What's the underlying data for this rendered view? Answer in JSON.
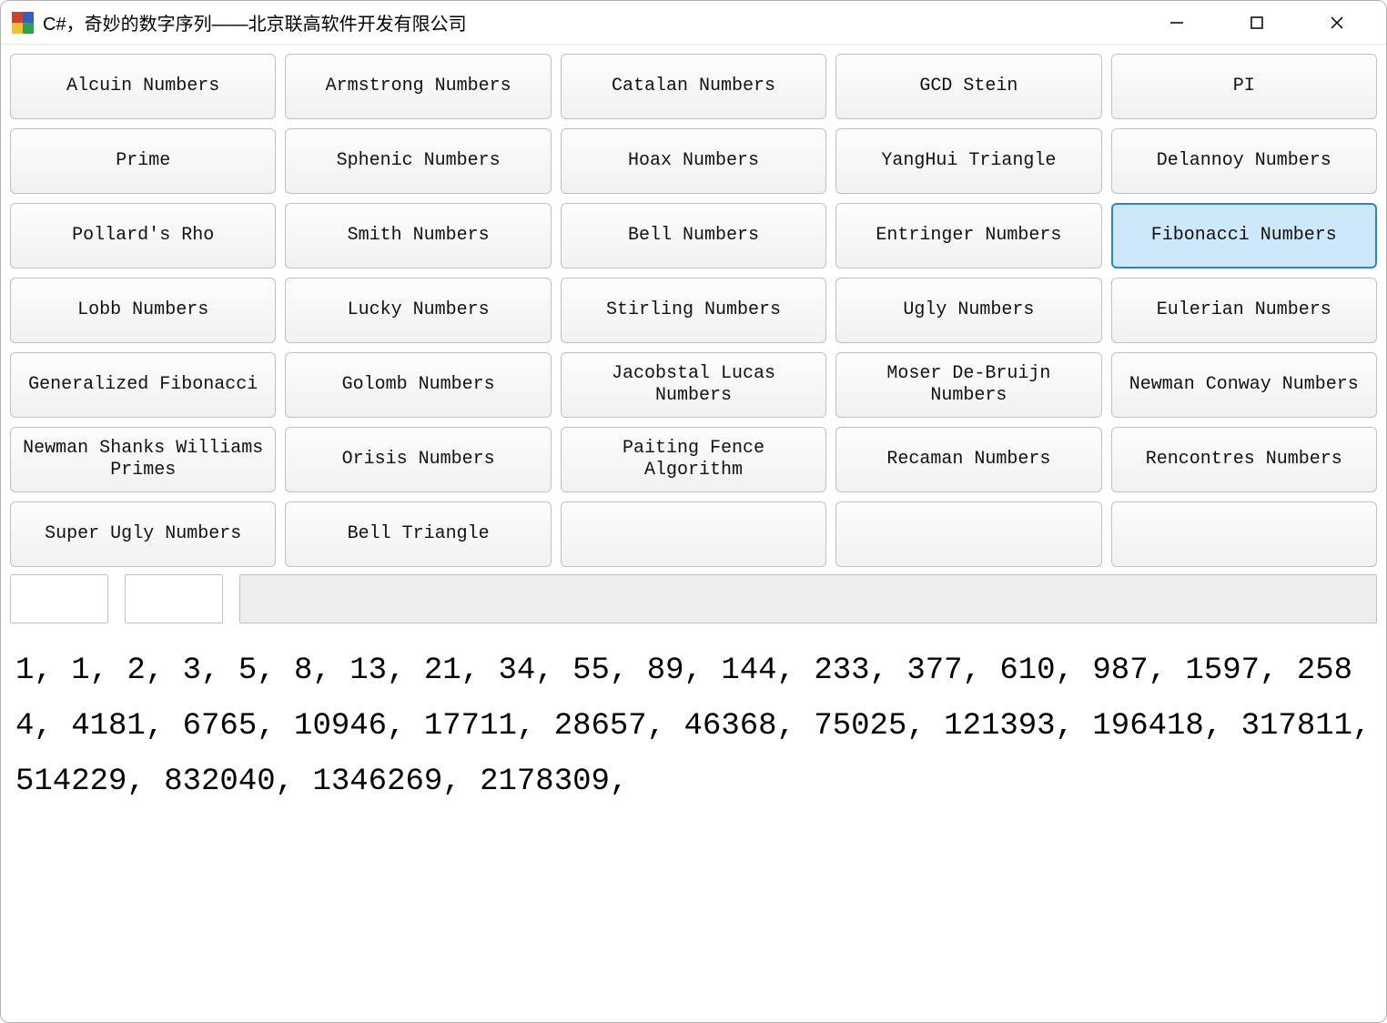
{
  "window": {
    "title": "C#，奇妙的数字序列——北京联高软件开发有限公司"
  },
  "buttons": [
    {
      "label": "Alcuin Numbers",
      "selected": false
    },
    {
      "label": "Armstrong Numbers",
      "selected": false
    },
    {
      "label": "Catalan Numbers",
      "selected": false
    },
    {
      "label": "GCD Stein",
      "selected": false
    },
    {
      "label": "PI",
      "selected": false
    },
    {
      "label": "Prime",
      "selected": false
    },
    {
      "label": "Sphenic Numbers",
      "selected": false
    },
    {
      "label": "Hoax Numbers",
      "selected": false
    },
    {
      "label": "YangHui Triangle",
      "selected": false
    },
    {
      "label": "Delannoy Numbers",
      "selected": false
    },
    {
      "label": "Pollard's Rho",
      "selected": false
    },
    {
      "label": "Smith Numbers",
      "selected": false
    },
    {
      "label": "Bell Numbers",
      "selected": false
    },
    {
      "label": "Entringer Numbers",
      "selected": false
    },
    {
      "label": "Fibonacci Numbers",
      "selected": true
    },
    {
      "label": "Lobb Numbers",
      "selected": false
    },
    {
      "label": "Lucky Numbers",
      "selected": false
    },
    {
      "label": "Stirling Numbers",
      "selected": false
    },
    {
      "label": "Ugly Numbers",
      "selected": false
    },
    {
      "label": "Eulerian Numbers",
      "selected": false
    },
    {
      "label": "Generalized Fibonacci",
      "selected": false
    },
    {
      "label": "Golomb Numbers",
      "selected": false
    },
    {
      "label": "Jacobstal Lucas Numbers",
      "selected": false
    },
    {
      "label": "Moser De-Bruijn Numbers",
      "selected": false
    },
    {
      "label": "Newman Conway Numbers",
      "selected": false
    },
    {
      "label": "Newman Shanks Williams Primes",
      "selected": false
    },
    {
      "label": "Orisis Numbers",
      "selected": false
    },
    {
      "label": "Paiting Fence Algorithm",
      "selected": false
    },
    {
      "label": "Recaman Numbers",
      "selected": false
    },
    {
      "label": "Rencontres Numbers",
      "selected": false
    },
    {
      "label": "Super Ugly Numbers",
      "selected": false
    },
    {
      "label": "Bell Triangle",
      "selected": false
    },
    {
      "label": "",
      "selected": false
    },
    {
      "label": "",
      "selected": false
    },
    {
      "label": "",
      "selected": false
    }
  ],
  "output_text": "1, 1, 2, 3, 5, 8, 13, 21, 34, 55, 89, 144, 233, 377, 610, 987, 1597, 2584, 4181, 6765, 10946, 17711, 28657, 46368, 75025, 121393, 196418, 317811, 514229, 832040, 1346269, 2178309,"
}
